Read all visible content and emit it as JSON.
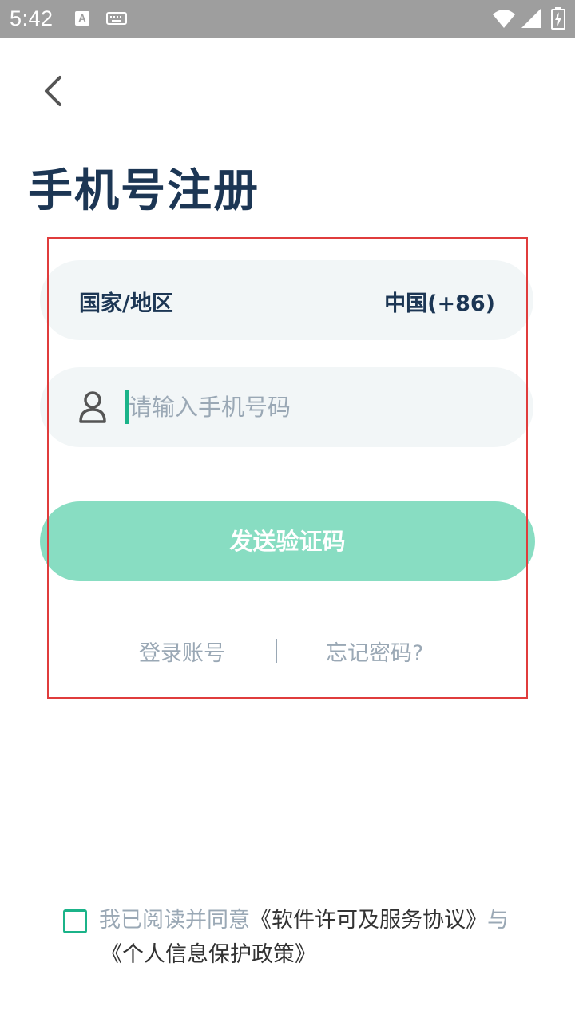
{
  "status_bar": {
    "time": "5:42",
    "notification_icon": "A"
  },
  "header": {
    "title": "手机号注册"
  },
  "form": {
    "region_label": "国家/地区",
    "region_value": "中国(+86)",
    "phone_placeholder": "请输入手机号码",
    "phone_value": "",
    "send_code_label": "发送验证码"
  },
  "links": {
    "login": "登录账号",
    "separator": "|",
    "forgot_password": "忘记密码?"
  },
  "agreement": {
    "prefix": "我已阅读并同意",
    "license_link": "《软件许可及服务协议》",
    "connector": "与",
    "privacy_link": "《个人信息保护政策》",
    "checked": false
  },
  "colors": {
    "title": "#1c3654",
    "accent": "#1bb389",
    "button": "#88ddc2",
    "input_bg": "#f2f6f7",
    "muted": "#9aa8b5",
    "highlight_border": "#e03c3c"
  },
  "icons": {
    "back": "chevron-left-icon",
    "user": "user-icon",
    "checkbox": "checkbox-icon"
  }
}
